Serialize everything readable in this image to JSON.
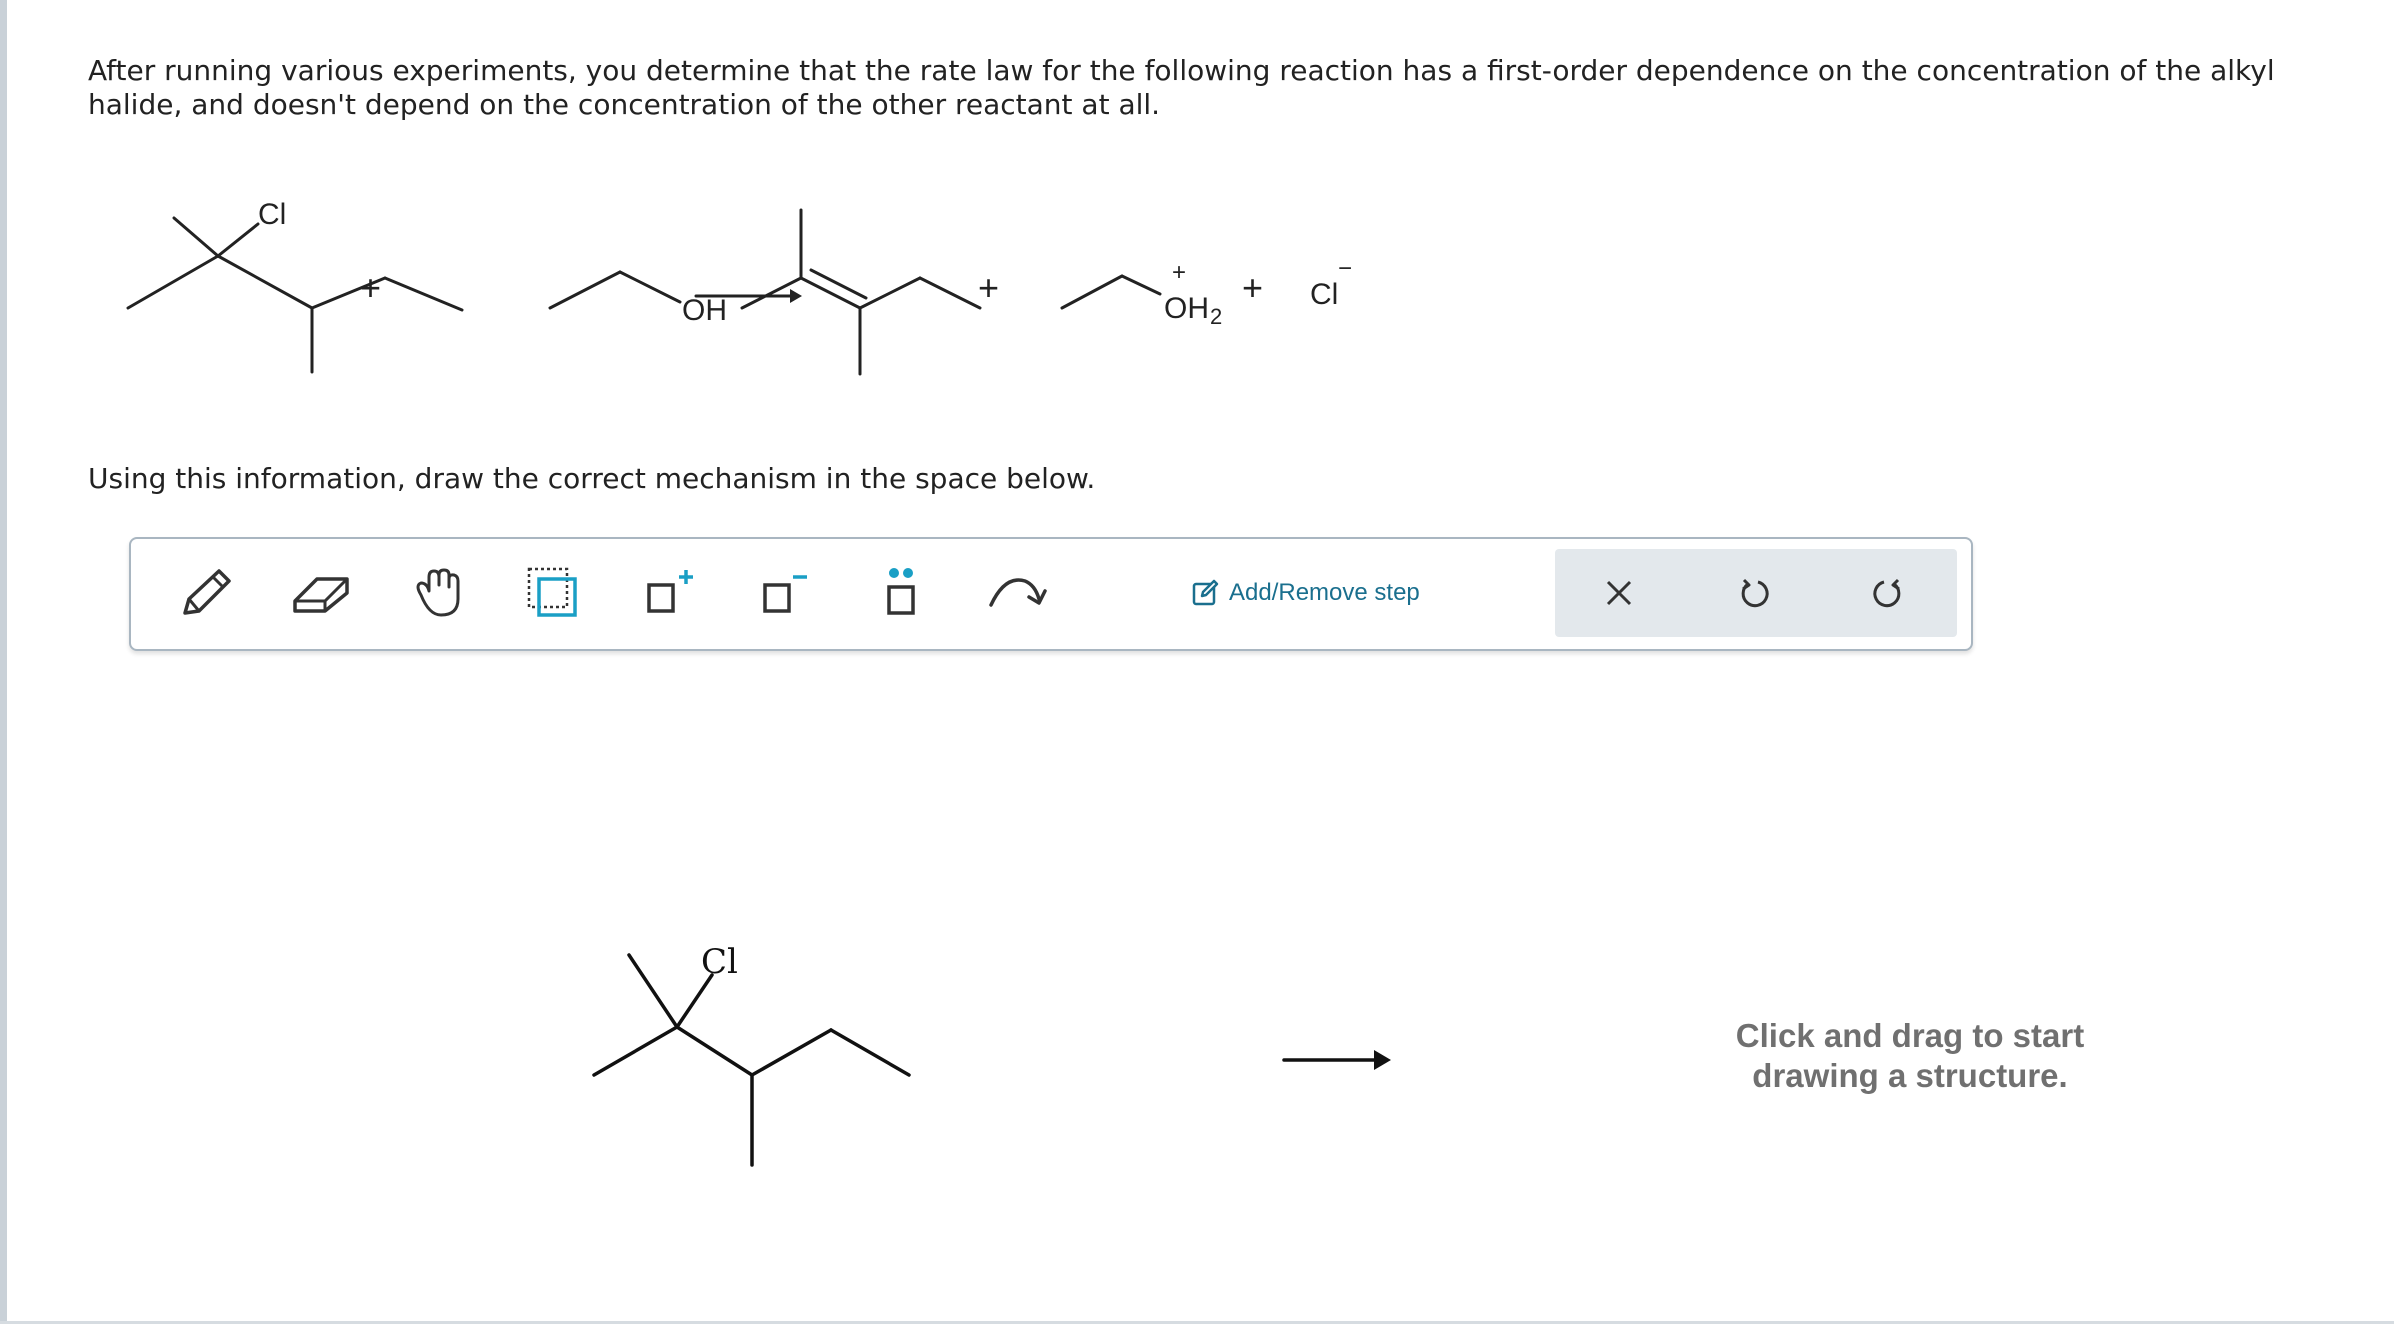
{
  "question": {
    "text": "After running various experiments, you determine that the rate law for the following reaction has a first-order dependence on the concentration of the alkyl halide, and doesn't depend on the concentration of the other reactant at all."
  },
  "reaction": {
    "reactant1_label": "Cl",
    "plus": "+",
    "reactant2_label": "OH",
    "product2_label": "OH",
    "product2_subscript": "2",
    "product2_charge": "+",
    "product3_label": "Cl",
    "product3_charge": "−"
  },
  "instruction": {
    "text": "Using this information, draw the correct mechanism in the space below."
  },
  "toolbar": {
    "tools": [
      {
        "name": "pencil-icon"
      },
      {
        "name": "eraser-icon"
      },
      {
        "name": "hand-icon"
      },
      {
        "name": "selection-box-icon"
      },
      {
        "name": "add-positive-charge-icon"
      },
      {
        "name": "add-negative-charge-icon"
      },
      {
        "name": "add-lone-pair-icon"
      },
      {
        "name": "curved-arrow-icon"
      }
    ],
    "add_remove_step_label": "Add/Remove step",
    "clear_icon": "close-icon",
    "undo_icon": "undo-icon",
    "redo_icon": "redo-icon",
    "accent_color": "#1a9fc5",
    "step_color": "#1a6f8e"
  },
  "canvas": {
    "starting_structure_label": "Cl",
    "hint_line1": "Click and drag to start",
    "hint_line2": "drawing a structure."
  }
}
